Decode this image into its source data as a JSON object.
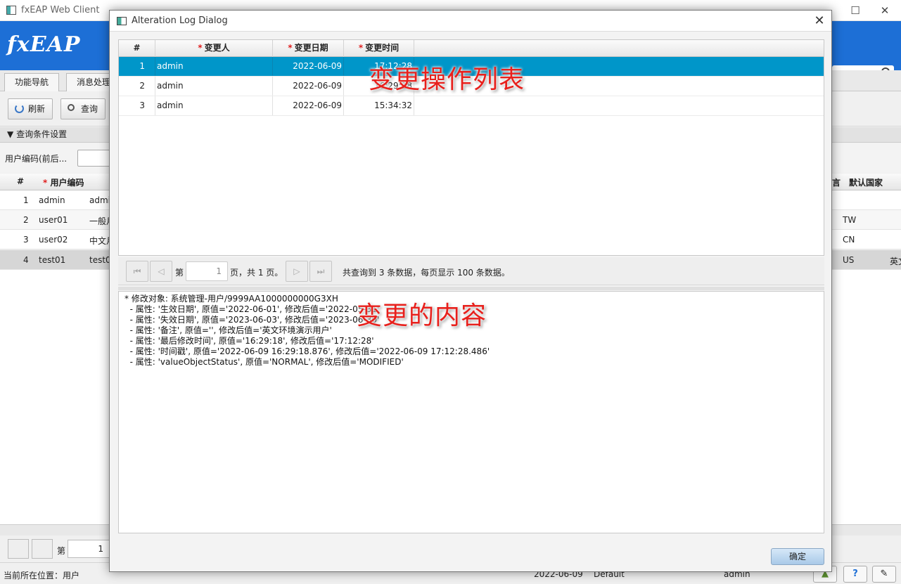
{
  "app": {
    "title": "fxEAP Web Client",
    "logo": "fxEAP",
    "nav_tabs": [
      "功能导航",
      "消息处理"
    ],
    "toolbar": {
      "refresh": "刷新",
      "query": "查询"
    },
    "condition_header": "查询条件设置",
    "condition_label": "用户编码(前后...",
    "grid_headers": {
      "idx": "#",
      "code": "用户编码",
      "right_partial": "言",
      "country": "默认国家"
    },
    "grid_rows": [
      {
        "idx": "1",
        "code": "admin",
        "name": "admi",
        "country": "",
        "extra": ""
      },
      {
        "idx": "2",
        "code": "user01",
        "name": "一般月",
        "country": "TW",
        "extra": ""
      },
      {
        "idx": "3",
        "code": "user02",
        "name": "中文月",
        "country": "CN",
        "extra": ""
      },
      {
        "idx": "4",
        "code": "test01",
        "name": "test0",
        "country": "US",
        "extra": "英文"
      }
    ],
    "pager": {
      "label": "第",
      "page": "1"
    },
    "status": {
      "location": "当前所在位置：用户",
      "date": "2022-06-09",
      "profile": "Default",
      "user": "admin"
    }
  },
  "dialog": {
    "title": "Alteration Log Dialog",
    "columns": {
      "idx": "#",
      "user": "变更人",
      "date": "变更日期",
      "time": "变更时间"
    },
    "rows": [
      {
        "idx": "1",
        "user": "admin",
        "date": "2022-06-09",
        "time": "17:12:28",
        "selected": true
      },
      {
        "idx": "2",
        "user": "admin",
        "date": "2022-06-09",
        "time": "16:29:18",
        "selected": false
      },
      {
        "idx": "3",
        "user": "admin",
        "date": "2022-06-09",
        "time": "15:34:32",
        "selected": false
      }
    ],
    "pager": {
      "prefix": "第",
      "page": "1",
      "suffix": "页，共 1 页。",
      "summary": "共查询到 3 条数据，每页显示 100 条数据。"
    },
    "change_lines": [
      "* 修改对象: 系统管理-用户/9999AA1000000000G3XH",
      "  - 属性: '生效日期', 原值='2022-06-01', 修改后值='2022-05-31'",
      "  - 属性: '失效日期', 原值='2023-06-03', 修改后值='2023-06-30'",
      "  - 属性: '备注', 原值='', 修改后值='英文环境演示用户'",
      "  - 属性: '最后修改时间', 原值='16:29:18', 修改后值='17:12:28'",
      "  - 属性: '时间戳', 原值='2022-06-09 16:29:18.876', 修改后值='2022-06-09 17:12:28.486'",
      "  - 属性: 'valueObjectStatus', 原值='NORMAL', 修改后值='MODIFIED'"
    ],
    "ok_label": "确定"
  },
  "annotations": {
    "list": "变更操作列表",
    "content": "变更的内容"
  },
  "colors": {
    "header_blue": "#1d6fd6",
    "selection_blue": "#0096c9",
    "required_star": "#e02020",
    "annotation_red": "#e8201c"
  }
}
